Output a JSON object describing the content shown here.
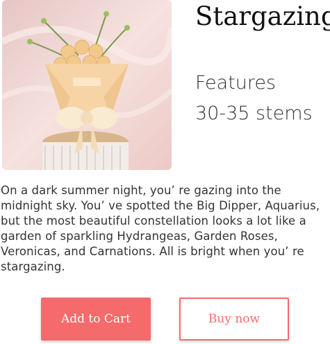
{
  "product": {
    "title": "Stargazing",
    "features_label": "Features",
    "stems": "30-35 stems",
    "image_alt": "Stargazing bouquet",
    "description": "On a dark summer night, you’ re gazing into the midnight sky. You’ ve spotted the Big Dipper, Aquarius, but the most beautiful constellation looks a lot like a garden of sparkling Hydrangeas, Garden Roses, Veronicas, and Carnations. All is bright when you’ re stargazing."
  },
  "actions": {
    "add_to_cart": "Add to Cart",
    "buy_now": "Buy now"
  },
  "colors": {
    "accent": "#f56b6b",
    "image_bg": "#f3d9d6"
  }
}
